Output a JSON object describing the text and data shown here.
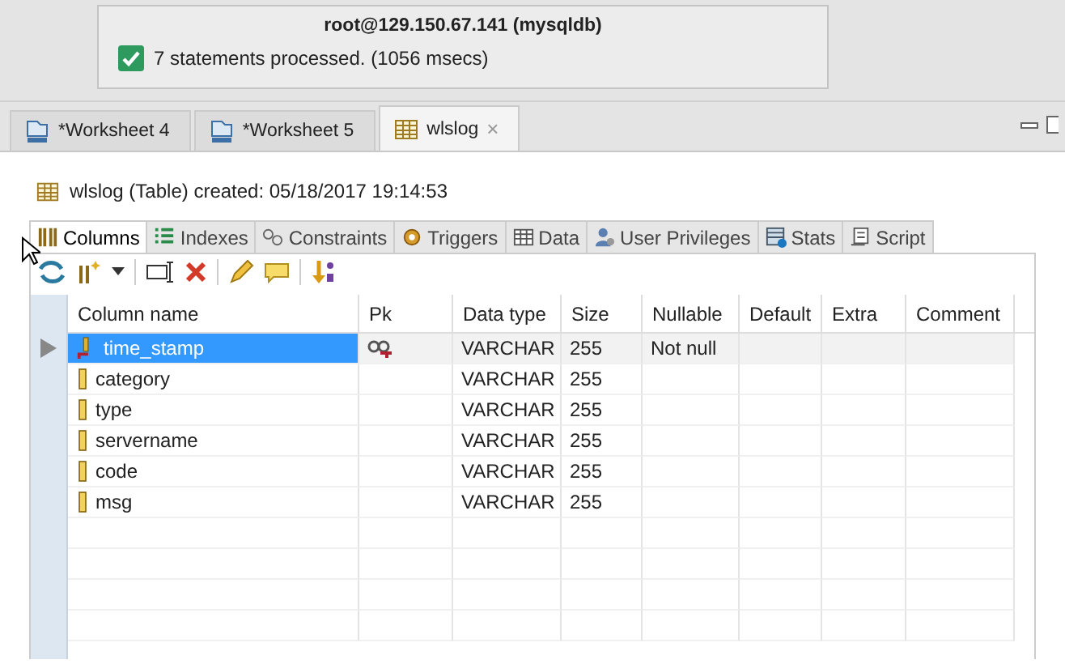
{
  "notification": {
    "title": "root@129.150.67.141 (mysqldb)",
    "message": "7 statements processed. (1056 msecs)",
    "success": true
  },
  "tabs": [
    {
      "label": "*Worksheet 4",
      "kind": "sql",
      "selected": false
    },
    {
      "label": "*Worksheet 5",
      "kind": "sql",
      "selected": false
    },
    {
      "label": "wlslog",
      "kind": "table",
      "selected": true,
      "close": "×"
    }
  ],
  "header": {
    "text": "wlslog (Table) created: 05/18/2017 19:14:53"
  },
  "subtabs": [
    {
      "label": "Columns",
      "selected": true
    },
    {
      "label": "Indexes",
      "selected": false
    },
    {
      "label": "Constraints",
      "selected": false
    },
    {
      "label": "Triggers",
      "selected": false
    },
    {
      "label": "Data",
      "selected": false
    },
    {
      "label": "User Privileges",
      "selected": false
    },
    {
      "label": "Stats",
      "selected": false
    },
    {
      "label": "Script",
      "selected": false
    }
  ],
  "table": {
    "columns": [
      "Column name",
      "Pk",
      "Data type",
      "Size",
      "Nullable",
      "Default",
      "Extra",
      "Comment"
    ],
    "rows": [
      {
        "name": "time_stamp",
        "primary_key": true,
        "data_type": "VARCHAR",
        "size": "255",
        "nullable": "Not null",
        "selected": true
      },
      {
        "name": "category",
        "primary_key": false,
        "data_type": "VARCHAR",
        "size": "255",
        "selected": false
      },
      {
        "name": "type",
        "primary_key": false,
        "data_type": "VARCHAR",
        "size": "255",
        "selected": false
      },
      {
        "name": "servername",
        "primary_key": false,
        "data_type": "VARCHAR",
        "size": "255",
        "selected": false
      },
      {
        "name": "code",
        "primary_key": false,
        "data_type": "VARCHAR",
        "size": "255",
        "selected": false
      },
      {
        "name": "msg",
        "primary_key": false,
        "data_type": "VARCHAR",
        "size": "255",
        "selected": false
      }
    ]
  }
}
